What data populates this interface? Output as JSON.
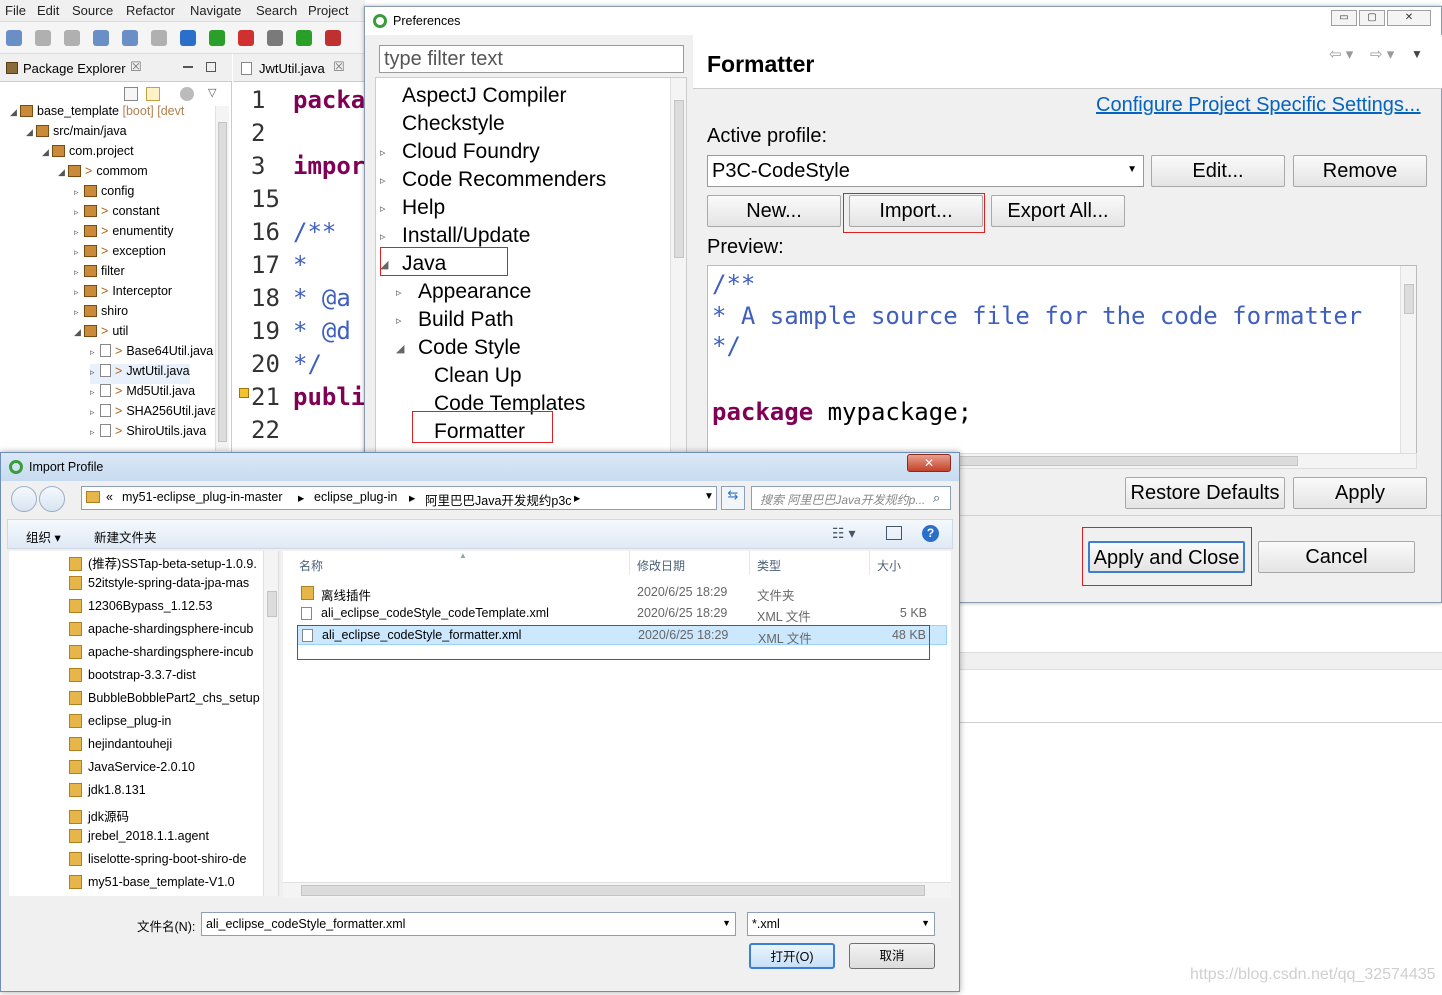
{
  "menubar": {
    "items": [
      "File",
      "Edit",
      "Source",
      "Refactor",
      "Navigate",
      "Search",
      "Project"
    ]
  },
  "package_explorer": {
    "tab": "Package Explorer",
    "tab_close": "☒",
    "rows": [
      {
        "label": "base_template",
        "suffix": " [boot] [devt"
      },
      {
        "label": "src/main/java"
      },
      {
        "label": "com.project"
      },
      {
        "label": "commom"
      },
      {
        "label": "config"
      },
      {
        "label": "constant"
      },
      {
        "label": "enumentity"
      },
      {
        "label": "exception"
      },
      {
        "label": "filter"
      },
      {
        "label": "Interceptor"
      },
      {
        "label": "shiro"
      },
      {
        "label": "util"
      },
      {
        "label": "Base64Util.java"
      },
      {
        "label": "JwtUtil.java"
      },
      {
        "label": "Md5Util.java"
      },
      {
        "label": "SHA256Util.java"
      },
      {
        "label": "ShiroUtils.java"
      }
    ]
  },
  "editor": {
    "tab": "JwtUtil.java",
    "lines": [
      {
        "num": "1",
        "code": "packa",
        "kind": "kw"
      },
      {
        "num": "2",
        "code": "",
        "kind": "plain"
      },
      {
        "num": "3",
        "code": "impor",
        "kind": "kw"
      },
      {
        "num": "15",
        "code": "",
        "kind": "plain"
      },
      {
        "num": "16",
        "code": "/**",
        "kind": "doc"
      },
      {
        "num": "17",
        "code": " *",
        "kind": "doc"
      },
      {
        "num": "18",
        "code": " * @a",
        "kind": "doc"
      },
      {
        "num": "19",
        "code": " * @d",
        "kind": "doc"
      },
      {
        "num": "20",
        "code": " */",
        "kind": "doc"
      },
      {
        "num": "21",
        "code": "publi",
        "kind": "kw"
      },
      {
        "num": "22",
        "code": "",
        "kind": "plain"
      }
    ]
  },
  "preferences": {
    "title": "Preferences",
    "filter_placeholder": "type filter text",
    "tree": [
      {
        "label": "AspectJ Compiler",
        "twisty": ""
      },
      {
        "label": "Checkstyle",
        "twisty": ""
      },
      {
        "label": "Cloud Foundry",
        "twisty": "▹"
      },
      {
        "label": "Code Recommenders",
        "twisty": "▹"
      },
      {
        "label": "Help",
        "twisty": "▹"
      },
      {
        "label": "Install/Update",
        "twisty": "▹"
      },
      {
        "label": "Java",
        "twisty": "◢"
      },
      {
        "label": "Appearance",
        "twisty": "▹"
      },
      {
        "label": "Build Path",
        "twisty": "▹"
      },
      {
        "label": "Code Style",
        "twisty": "◢"
      },
      {
        "label": "Clean Up",
        "twisty": ""
      },
      {
        "label": "Code Templates",
        "twisty": ""
      },
      {
        "label": "Formatter",
        "twisty": ""
      }
    ],
    "page_title": "Formatter",
    "configure_link": "Configure Project Specific Settings...",
    "active_profile_label": "Active profile:",
    "active_profile_value": "P3C-CodeStyle",
    "edit_label": "Edit...",
    "remove_label": "Remove",
    "new_label": "New...",
    "import_label": "Import...",
    "export_label": "Export All...",
    "preview_label": "Preview:",
    "preview_lines": [
      "/**",
      " * A sample source file for the code formatter",
      " */",
      "",
      "package mypackage;"
    ],
    "restore_label": "Restore Defaults",
    "apply_label": "Apply",
    "apply_close_label": "Apply and Close",
    "cancel_label": "Cancel"
  },
  "import_dialog": {
    "title": "Import Profile",
    "close": "✕",
    "path": [
      "my51-eclipse_plug-in-master",
      "eclipse_plug-in",
      "阿里巴巴Java开发规约p3c"
    ],
    "path_lead": "«",
    "search_placeholder": "搜索 阿里巴巴Java开发规约p...",
    "organize_label": "组织 ▾",
    "new_folder_label": "新建文件夹",
    "left_folders": [
      "(推荐)SSTap-beta-setup-1.0.9.",
      "52itstyle-spring-data-jpa-mas",
      "12306Bypass_1.12.53",
      "apache-shardingsphere-incub",
      "apache-shardingsphere-incub",
      "bootstrap-3.3.7-dist",
      "BubbleBobblePart2_chs_setup",
      "eclipse_plug-in",
      "hejindantouheji",
      "JavaService-2.0.10",
      "jdk1.8.131",
      "jdk源码",
      "jrebel_2018.1.1.agent",
      "liselotte-spring-boot-shiro-de",
      "my51-base_template-V1.0"
    ],
    "columns": {
      "name": "名称",
      "date": "修改日期",
      "type": "类型",
      "size": "大小"
    },
    "files": [
      {
        "name": "离线插件",
        "date": "2020/6/25 18:29",
        "type": "文件夹",
        "size": "",
        "kind": "folder"
      },
      {
        "name": "ali_eclipse_codeStyle_codeTemplate.xml",
        "date": "2020/6/25 18:29",
        "type": "XML 文件",
        "size": "5 KB",
        "kind": "file"
      },
      {
        "name": "ali_eclipse_codeStyle_formatter.xml",
        "date": "2020/6/25 18:29",
        "type": "XML 文件",
        "size": "48 KB",
        "kind": "file"
      }
    ],
    "filename_label": "文件名(N):",
    "filename_value": "ali_eclipse_codeStyle_formatter.xml",
    "filetype_value": "*.xml",
    "open_label": "打开(O)",
    "cancel_label": "取消"
  },
  "watermark": "https://blog.csdn.net/qq_32574435",
  "colors": {
    "keyword": "#7f0055",
    "javadoc": "#3f5fbf",
    "link": "#0563c1",
    "highlight": "#e02020",
    "selection": "#cce8ff"
  }
}
